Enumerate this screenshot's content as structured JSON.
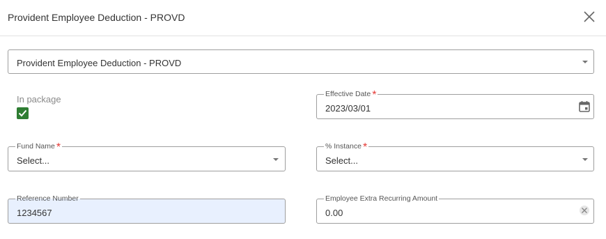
{
  "dialog": {
    "title": "Provident Employee Deduction - PROVD",
    "close_icon": "close-icon"
  },
  "deduction_select": {
    "value": "Provident Employee Deduction - PROVD",
    "icon": "chevron-down-icon"
  },
  "in_package": {
    "label": "In package",
    "checked": true,
    "color": "#2e7d32"
  },
  "effective_date": {
    "label": "Effective Date",
    "required_mark": "*",
    "value": "2023/03/01",
    "icon": "calendar-icon"
  },
  "fund_name": {
    "label": "Fund Name",
    "required_mark": "*",
    "value": "Select...",
    "icon": "chevron-down-icon"
  },
  "instance": {
    "label": "% Instance",
    "required_mark": "*",
    "value": "Select...",
    "icon": "chevron-down-icon"
  },
  "reference_number": {
    "label": "Reference Number",
    "value": "1234567",
    "background": "#e8f0fe"
  },
  "extra_amount": {
    "label": "Employee Extra Recurring Amount",
    "value": "0.00",
    "icon": "clear-icon"
  },
  "colors": {
    "required": "#e53935",
    "border": "#9e9e9e"
  }
}
